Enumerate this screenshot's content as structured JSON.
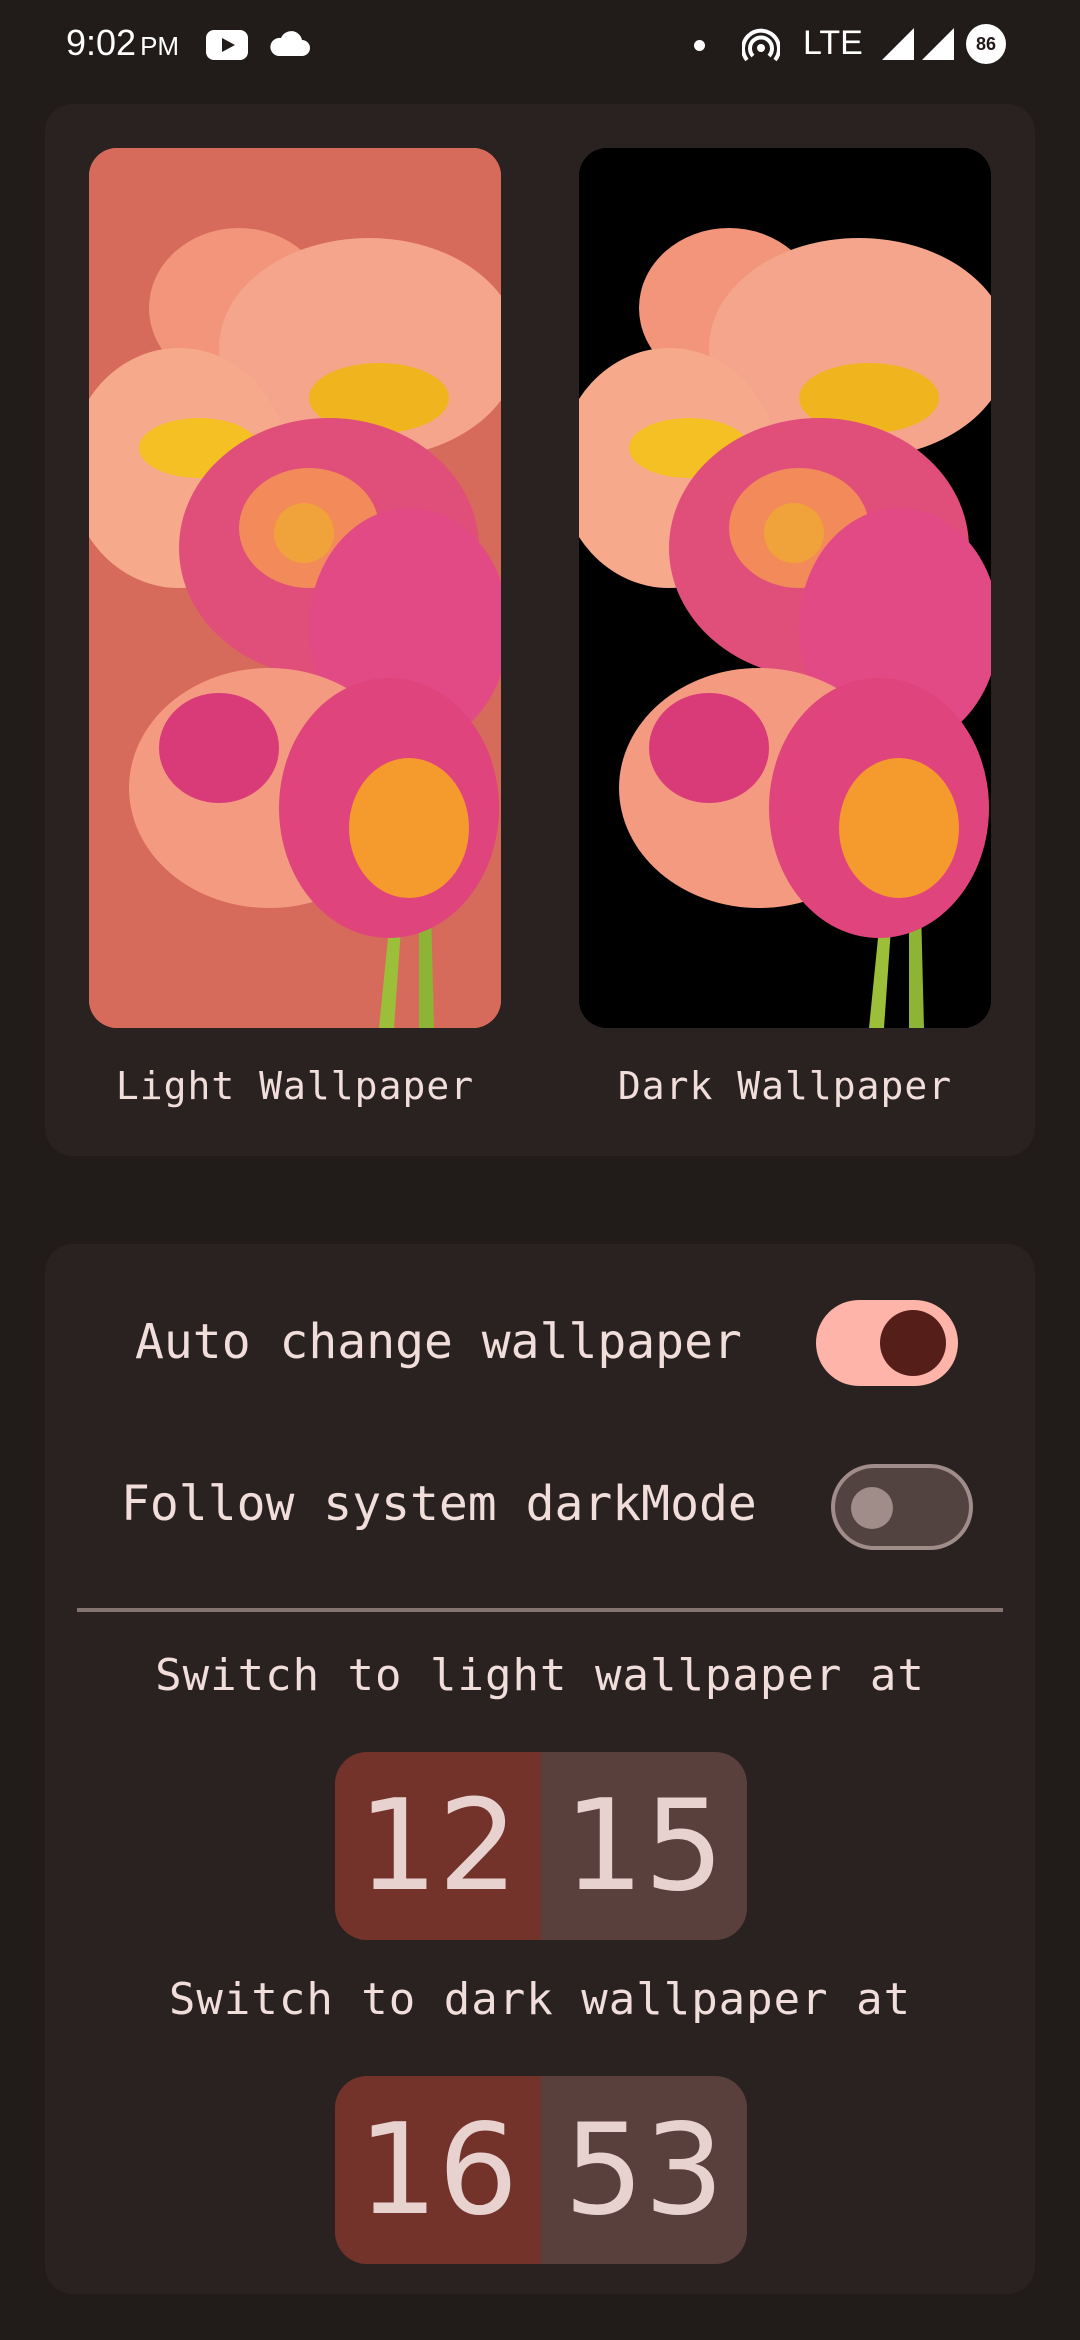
{
  "status_bar": {
    "time": "9:02",
    "ampm": "PM",
    "network": "LTE",
    "battery": "86",
    "icons": [
      "youtube-icon",
      "cloud-icon",
      "dot-icon",
      "hotspot-icon",
      "signal-icon",
      "signal-icon",
      "battery-icon"
    ]
  },
  "wallpapers": {
    "light_label": "Light Wallpaper",
    "dark_label": "Dark Wallpaper",
    "light_bg": "#d76b5b",
    "dark_bg": "#000000"
  },
  "settings": {
    "auto_change_label": "Auto change wallpaper",
    "auto_change_on": true,
    "follow_dark_label": "Follow system darkMode",
    "follow_dark_on": false,
    "light_time_label": "Switch to light wallpaper at",
    "light_time": {
      "hour": "12",
      "minute": "15"
    },
    "dark_time_label": "Switch to dark wallpaper at",
    "dark_time": {
      "hour": "16",
      "minute": "53"
    }
  },
  "colors": {
    "background": "#211b1a",
    "card": "#2a2221",
    "toggle_on": "#ffb4a9",
    "hour_box": "#73332b",
    "minute_box": "#5a403d"
  }
}
